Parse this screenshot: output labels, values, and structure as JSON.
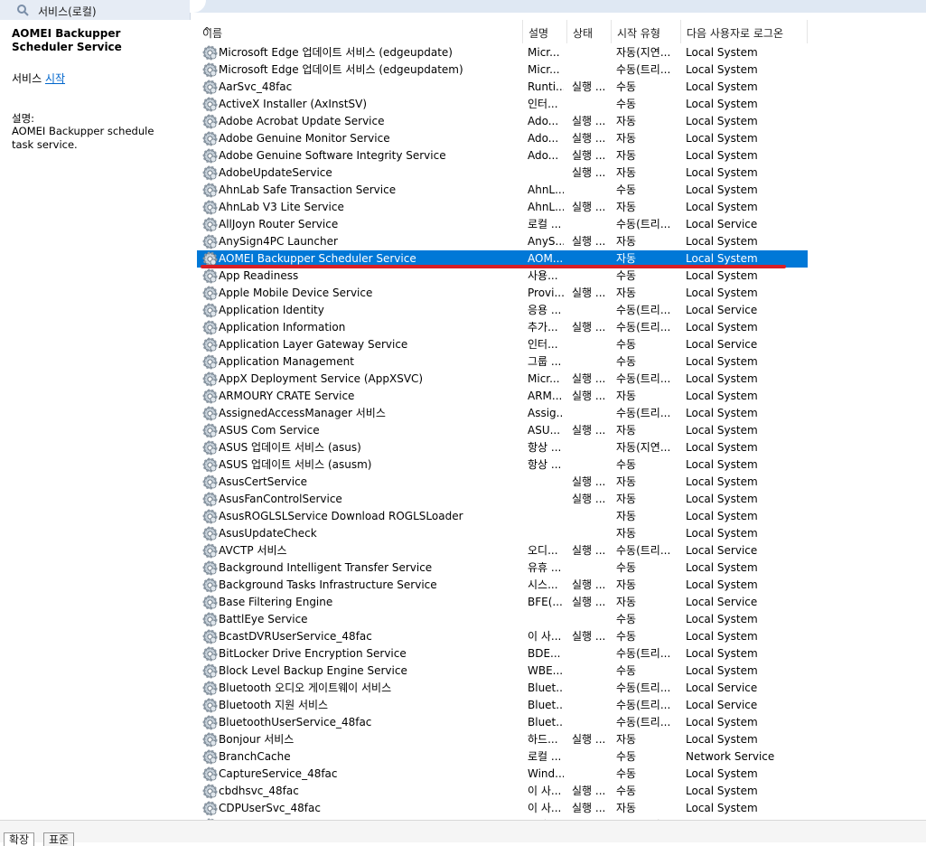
{
  "window": {
    "tab_title": "서비스(로컬)"
  },
  "left_panel": {
    "service_title": "AOMEI Backupper Scheduler Service",
    "action_prefix": "서비스 ",
    "action_link": "시작",
    "desc_label": "설명:",
    "desc_text": "AOMEI Backupper schedule task service."
  },
  "columns": [
    "이름",
    "설명",
    "상태",
    "시작 유형",
    "다음 사용자로 로그온"
  ],
  "selected_index": 12,
  "rows": [
    {
      "name": "Microsoft Edge 업데이트 서비스 (edgeupdate)",
      "desc": "Micr...",
      "status": "",
      "start": "자동(지연...",
      "logon": "Local System"
    },
    {
      "name": "Microsoft Edge 업데이트 서비스 (edgeupdatem)",
      "desc": "Micr...",
      "status": "",
      "start": "수동(트리...",
      "logon": "Local System"
    },
    {
      "name": "AarSvc_48fac",
      "desc": "Runti...",
      "status": "실행 ...",
      "start": "수동",
      "logon": "Local System"
    },
    {
      "name": "ActiveX Installer (AxInstSV)",
      "desc": "인터...",
      "status": "",
      "start": "수동",
      "logon": "Local System"
    },
    {
      "name": "Adobe Acrobat Update Service",
      "desc": "Ado...",
      "status": "실행 ...",
      "start": "자동",
      "logon": "Local System"
    },
    {
      "name": "Adobe Genuine Monitor Service",
      "desc": "Ado...",
      "status": "실행 ...",
      "start": "자동",
      "logon": "Local System"
    },
    {
      "name": "Adobe Genuine Software Integrity Service",
      "desc": "Ado...",
      "status": "실행 ...",
      "start": "자동",
      "logon": "Local System"
    },
    {
      "name": "AdobeUpdateService",
      "desc": "",
      "status": "실행 ...",
      "start": "자동",
      "logon": "Local System"
    },
    {
      "name": "AhnLab Safe Transaction Service",
      "desc": "AhnL...",
      "status": "",
      "start": "수동",
      "logon": "Local System"
    },
    {
      "name": "AhnLab V3 Lite Service",
      "desc": "AhnL...",
      "status": "실행 ...",
      "start": "자동",
      "logon": "Local System"
    },
    {
      "name": "AllJoyn Router Service",
      "desc": "로컬 ...",
      "status": "",
      "start": "수동(트리...",
      "logon": "Local Service"
    },
    {
      "name": "AnySign4PC Launcher",
      "desc": "AnyS...",
      "status": "실행 ...",
      "start": "자동",
      "logon": "Local System"
    },
    {
      "name": "AOMEI Backupper Scheduler Service",
      "desc": "AOM...",
      "status": "",
      "start": "자동",
      "logon": "Local System"
    },
    {
      "name": "App Readiness",
      "desc": "사용...",
      "status": "",
      "start": "수동",
      "logon": "Local System"
    },
    {
      "name": "Apple Mobile Device Service",
      "desc": "Provi...",
      "status": "실행 ...",
      "start": "자동",
      "logon": "Local System"
    },
    {
      "name": "Application Identity",
      "desc": "응용 ...",
      "status": "",
      "start": "수동(트리...",
      "logon": "Local Service"
    },
    {
      "name": "Application Information",
      "desc": "추가...",
      "status": "실행 ...",
      "start": "수동(트리...",
      "logon": "Local System"
    },
    {
      "name": "Application Layer Gateway Service",
      "desc": "인터...",
      "status": "",
      "start": "수동",
      "logon": "Local Service"
    },
    {
      "name": "Application Management",
      "desc": "그룹 ...",
      "status": "",
      "start": "수동",
      "logon": "Local System"
    },
    {
      "name": "AppX Deployment Service (AppXSVC)",
      "desc": "Micr...",
      "status": "실행 ...",
      "start": "수동(트리...",
      "logon": "Local System"
    },
    {
      "name": "ARMOURY CRATE Service",
      "desc": "ARM...",
      "status": "실행 ...",
      "start": "자동",
      "logon": "Local System"
    },
    {
      "name": "AssignedAccessManager 서비스",
      "desc": "Assig...",
      "status": "",
      "start": "수동(트리...",
      "logon": "Local System"
    },
    {
      "name": "ASUS Com Service",
      "desc": "ASU...",
      "status": "실행 ...",
      "start": "자동",
      "logon": "Local System"
    },
    {
      "name": "ASUS 업데이트 서비스 (asus)",
      "desc": "항상 ...",
      "status": "",
      "start": "자동(지연...",
      "logon": "Local System"
    },
    {
      "name": "ASUS 업데이트 서비스 (asusm)",
      "desc": "항상 ...",
      "status": "",
      "start": "수동",
      "logon": "Local System"
    },
    {
      "name": "AsusCertService",
      "desc": "",
      "status": "실행 ...",
      "start": "자동",
      "logon": "Local System"
    },
    {
      "name": "AsusFanControlService",
      "desc": "",
      "status": "실행 ...",
      "start": "자동",
      "logon": "Local System"
    },
    {
      "name": "AsusROGLSLService Download ROGLSLoader",
      "desc": "",
      "status": "",
      "start": "자동",
      "logon": "Local System"
    },
    {
      "name": "AsusUpdateCheck",
      "desc": "",
      "status": "",
      "start": "자동",
      "logon": "Local System"
    },
    {
      "name": "AVCTP 서비스",
      "desc": "오디...",
      "status": "실행 ...",
      "start": "수동(트리...",
      "logon": "Local Service"
    },
    {
      "name": "Background Intelligent Transfer Service",
      "desc": "유휴 ...",
      "status": "",
      "start": "수동",
      "logon": "Local System"
    },
    {
      "name": "Background Tasks Infrastructure Service",
      "desc": "시스...",
      "status": "실행 ...",
      "start": "자동",
      "logon": "Local System"
    },
    {
      "name": "Base Filtering Engine",
      "desc": "BFE(...",
      "status": "실행 ...",
      "start": "자동",
      "logon": "Local Service"
    },
    {
      "name": "BattlEye Service",
      "desc": "",
      "status": "",
      "start": "수동",
      "logon": "Local System"
    },
    {
      "name": "BcastDVRUserService_48fac",
      "desc": "이 사...",
      "status": "실행 ...",
      "start": "수동",
      "logon": "Local System"
    },
    {
      "name": "BitLocker Drive Encryption Service",
      "desc": "BDE...",
      "status": "",
      "start": "수동(트리...",
      "logon": "Local System"
    },
    {
      "name": "Block Level Backup Engine Service",
      "desc": "WBE...",
      "status": "",
      "start": "수동",
      "logon": "Local System"
    },
    {
      "name": "Bluetooth 오디오 게이트웨이 서비스",
      "desc": "Bluet...",
      "status": "",
      "start": "수동(트리...",
      "logon": "Local Service"
    },
    {
      "name": "Bluetooth 지원 서비스",
      "desc": "Bluet...",
      "status": "",
      "start": "수동(트리...",
      "logon": "Local Service"
    },
    {
      "name": "BluetoothUserService_48fac",
      "desc": "Bluet...",
      "status": "",
      "start": "수동(트리...",
      "logon": "Local System"
    },
    {
      "name": "Bonjour 서비스",
      "desc": "하드...",
      "status": "실행 ...",
      "start": "자동",
      "logon": "Local System"
    },
    {
      "name": "BranchCache",
      "desc": "로컬 ...",
      "status": "",
      "start": "수동",
      "logon": "Network Service"
    },
    {
      "name": "CaptureService_48fac",
      "desc": "Wind...",
      "status": "",
      "start": "수동",
      "logon": "Local System"
    },
    {
      "name": "cbdhsvc_48fac",
      "desc": "이 사...",
      "status": "실행 ...",
      "start": "수동",
      "logon": "Local System"
    },
    {
      "name": "CDPUserSvc_48fac",
      "desc": "이 사...",
      "status": "실행 ...",
      "start": "자동",
      "logon": "Local System"
    },
    {
      "name": "Certificate Propagation",
      "desc": "스마...",
      "status": "",
      "start": "수동(트리...",
      "logon": "Local System"
    }
  ],
  "bottom_tabs": [
    "확장",
    "표준"
  ]
}
